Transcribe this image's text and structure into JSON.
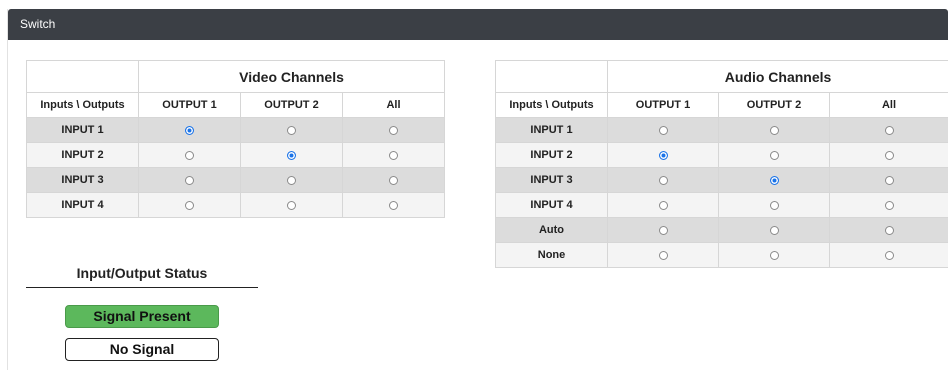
{
  "panel": {
    "title": "Switch"
  },
  "corner_label": "Inputs \\ Outputs",
  "video": {
    "title": "Video Channels",
    "columns": [
      "OUTPUT 1",
      "OUTPUT 2",
      "All"
    ],
    "rows": [
      {
        "label": "INPUT 1",
        "selected": [
          true,
          false,
          false
        ]
      },
      {
        "label": "INPUT 2",
        "selected": [
          false,
          true,
          false
        ]
      },
      {
        "label": "INPUT 3",
        "selected": [
          false,
          false,
          false
        ]
      },
      {
        "label": "INPUT 4",
        "selected": [
          false,
          false,
          false
        ]
      }
    ]
  },
  "audio": {
    "title": "Audio Channels",
    "columns": [
      "OUTPUT 1",
      "OUTPUT 2",
      "All"
    ],
    "rows": [
      {
        "label": "INPUT 1",
        "selected": [
          false,
          false,
          false
        ]
      },
      {
        "label": "INPUT 2",
        "selected": [
          true,
          false,
          false
        ]
      },
      {
        "label": "INPUT 3",
        "selected": [
          false,
          true,
          false
        ]
      },
      {
        "label": "INPUT 4",
        "selected": [
          false,
          false,
          false
        ]
      },
      {
        "label": "Auto",
        "selected": [
          false,
          false,
          false
        ]
      },
      {
        "label": "None",
        "selected": [
          false,
          false,
          false
        ]
      }
    ]
  },
  "status": {
    "title": "Input/Output Status",
    "signal_present": "Signal Present",
    "no_signal": "No Signal"
  },
  "colors": {
    "header_bg": "#3b3f45",
    "signal_present": "#5cb85c",
    "radio_checked": "#1a73e8"
  }
}
